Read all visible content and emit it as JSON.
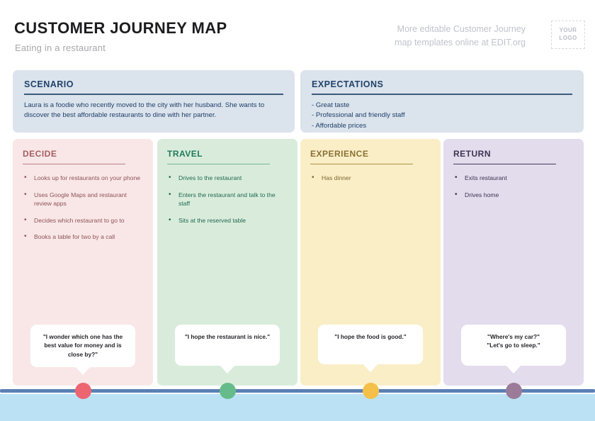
{
  "header": {
    "title": "CUSTOMER JOURNEY MAP",
    "subtitle": "Eating in a restaurant",
    "promo_line1": "More editable Customer Journey",
    "promo_line2": "map templates online at EDIT.org",
    "logo_line1": "YOUR",
    "logo_line2": "LOGO"
  },
  "panels": {
    "scenario": {
      "heading": "SCENARIO",
      "body": "Laura is a foodie who recently moved to the city with her husband. She wants to discover the best affordable restaurants to dine with her partner."
    },
    "expectations": {
      "heading": "EXPECTATIONS",
      "items": [
        "- Great taste",
        "- Professional and friendly staff",
        "- Affordable prices"
      ]
    }
  },
  "stages": [
    {
      "heading": "DECIDE",
      "bg": "#f9e7e7",
      "accent": "#a85d63",
      "rule": "#b98287",
      "text": "#8e5257",
      "dot": "#ed6570",
      "items": [
        "Looks up for restaurants on your phone",
        "Uses Google Maps and restaurant review apps",
        "Decides which restaurant to go to",
        "Books a table for two by a call"
      ],
      "quote": "\"I wonder which one has the best value for money and is close by?\""
    },
    {
      "heading": "TRAVEL",
      "bg": "#d9ecdc",
      "accent": "#1f7a5a",
      "rule": "#79b396",
      "text": "#21684f",
      "dot": "#66bb8a",
      "items": [
        "Drives to the restaurant",
        "Enters the restaurant and talk to the staff",
        "Sits at the reserved table"
      ],
      "quote": "\"I hope the restaurant is nice.\""
    },
    {
      "heading": "EXPERIENCE",
      "bg": "#faeec7",
      "accent": "#8a7134",
      "rule": "#ab9244",
      "text": "#7d672f",
      "dot": "#f5c049",
      "items": [
        "Has dinner"
      ],
      "quote": "\"I hope the food is good.\""
    },
    {
      "heading": "RETURN",
      "bg": "#e3dced",
      "accent": "#3b3550",
      "rule": "#463e5c",
      "text": "#3a3450",
      "dot": "#9c7b9a",
      "items": [
        "Exits restaurant",
        "Drives home"
      ],
      "quote": "\"Where's my car?\"\n\"Let's go to sleep.\""
    }
  ],
  "timeline": {
    "line_color": "#5b80b5",
    "band_color": "#bae2f4"
  }
}
